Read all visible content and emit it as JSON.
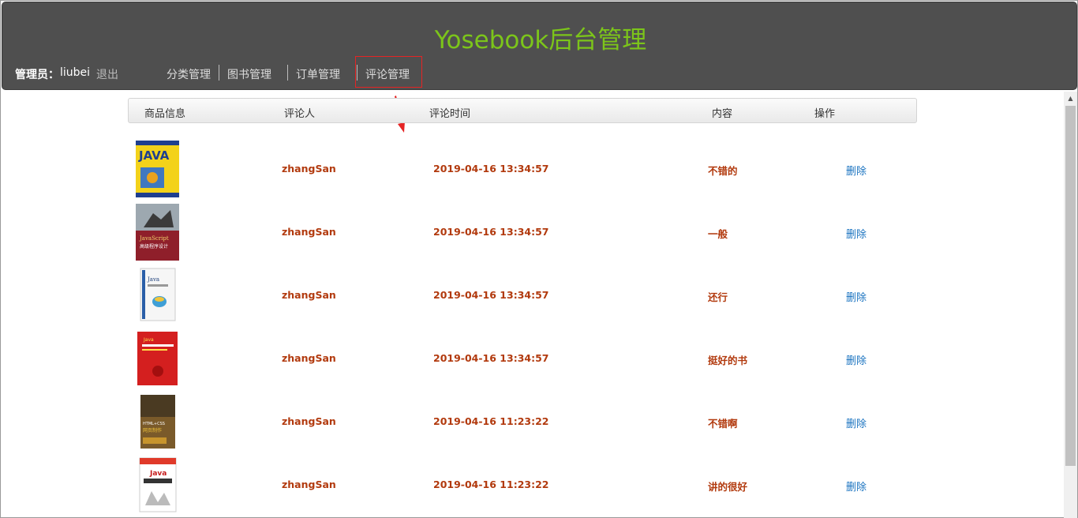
{
  "header": {
    "title": "Yosebook后台管理",
    "admin_label": "管理员：",
    "admin_name": "liubei",
    "logout_label": "退出",
    "nav": [
      "分类管理",
      "图书管理",
      "订单管理",
      "评论管理"
    ],
    "active_nav": "评论管理"
  },
  "table": {
    "columns": [
      "商品信息",
      "评论人",
      "评论时间",
      "内容",
      "操作"
    ],
    "rows": [
      {
        "book": "JAVA",
        "user": "zhangSan",
        "time": "2019-04-16 13:34:57",
        "content": "不错的",
        "action": "删除"
      },
      {
        "book": "JavaScript 高级程序设计",
        "user": "zhangSan",
        "time": "2019-04-16 13:34:57",
        "content": "一般",
        "action": "删除"
      },
      {
        "book": "Java",
        "user": "zhangSan",
        "time": "2019-04-16 13:34:57",
        "content": "还行",
        "action": "删除"
      },
      {
        "book": "Java",
        "user": "zhangSan",
        "time": "2019-04-16 13:34:57",
        "content": "挺好的书",
        "action": "删除"
      },
      {
        "book": "HTML+CSS+JavaScript 网页制作",
        "user": "zhangSan",
        "time": "2019-04-16 11:23:22",
        "content": "不错啊",
        "action": "删除"
      },
      {
        "book": "Java 从入门到精通",
        "user": "zhangSan",
        "time": "2019-04-16 11:23:22",
        "content": "讲的很好",
        "action": "删除"
      }
    ]
  },
  "colors": {
    "header_bg": "#4f4f4f",
    "title": "#7cc51a",
    "row_text": "#b23a0e",
    "link": "#1a73c0",
    "highlight": "#e52424"
  }
}
